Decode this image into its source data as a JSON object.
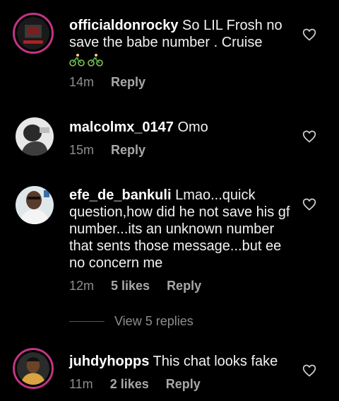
{
  "comments": [
    {
      "username": "officialdonrocky",
      "text": "So LIL Frosh no save the babe number . Cruise",
      "emoji": [
        "bicycle-emoji",
        "bicycle-emoji"
      ],
      "time": "14m",
      "reply": "Reply"
    },
    {
      "username": "malcolmx_0147",
      "text": "Omo",
      "time": "15m",
      "reply": "Reply"
    },
    {
      "username": "efe_de_bankuli",
      "text": "Lmao...quick question,how did he not save his gf number...its an unknown number that sents those message...but ee no concern me",
      "time": "12m",
      "likes": "5 likes",
      "reply": "Reply"
    },
    {
      "username": "juhdyhopps",
      "text": "This chat looks fake",
      "time": "11m",
      "likes": "2 likes",
      "reply": "Reply"
    }
  ],
  "view_replies": "View 5 replies",
  "colors": {
    "background": "#000000",
    "story_ring": "#c13584",
    "meta": "#8e8e8e"
  }
}
